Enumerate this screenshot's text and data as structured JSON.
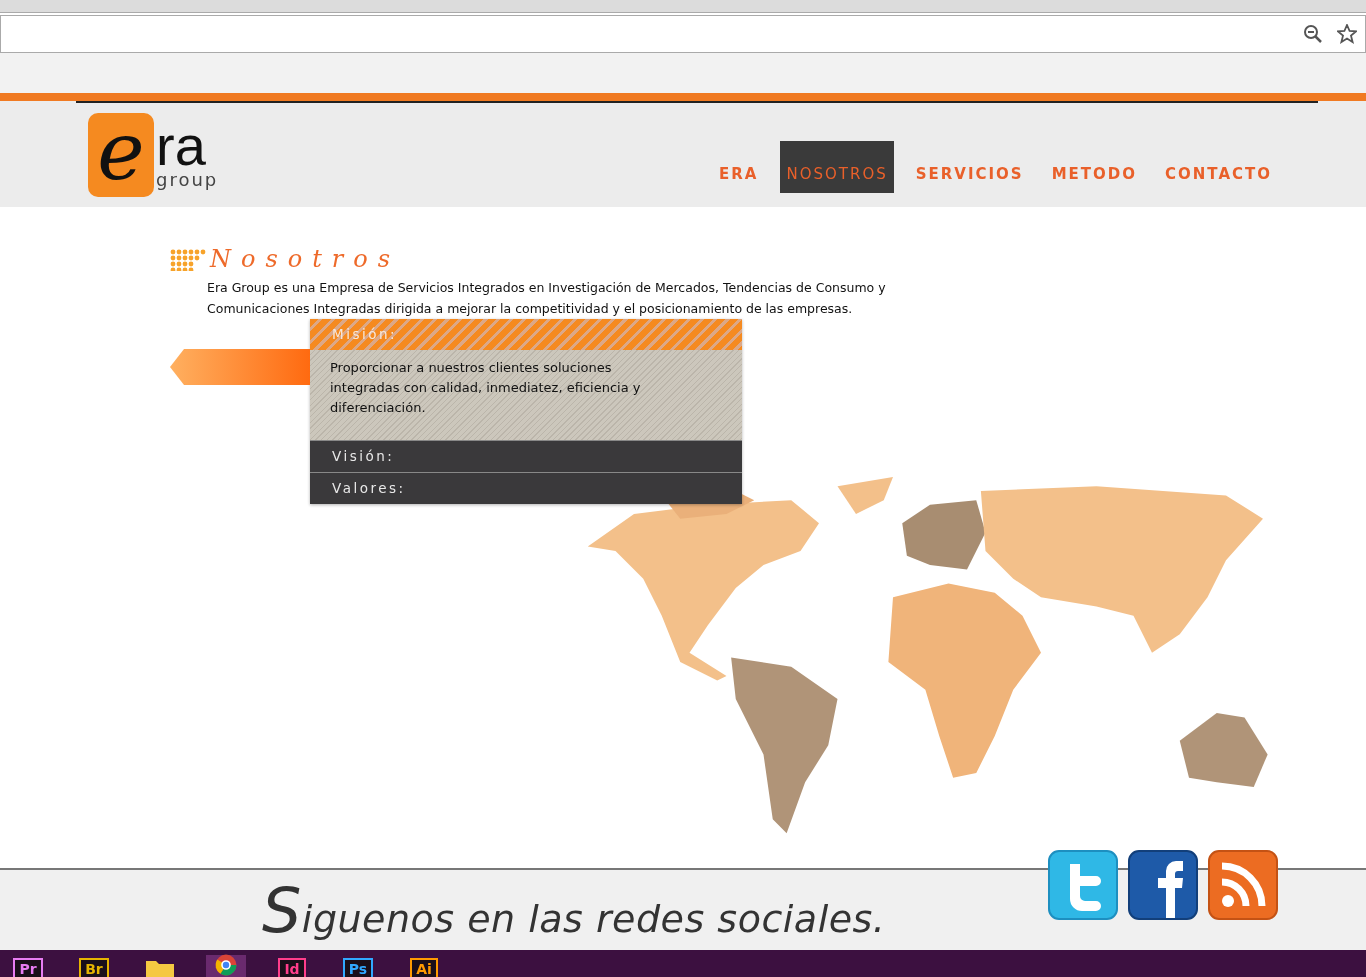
{
  "nav": [
    {
      "label": "ERA",
      "selected": false
    },
    {
      "label": "NOSOTROS",
      "selected": true
    },
    {
      "label": "SERVICIOS",
      "selected": false
    },
    {
      "label": "METODO",
      "selected": false
    },
    {
      "label": "CONTACTO",
      "selected": false
    }
  ],
  "logo": {
    "mark": "e",
    "word": "ra",
    "sub": "group"
  },
  "section": {
    "title": "Nosotros",
    "intro": "Era Group es una Empresa de Servicios Integrados en Investigación de Mercados, Tendencias de Consumo y Comunicaciones Integradas dirigida a mejorar la competitividad y el posicionamiento de las empresas."
  },
  "accordion": [
    {
      "title": "Misión:",
      "expanded": true,
      "body": "Proporcionar a nuestros clientes soluciones integradas con calidad, inmediatez, eficiencia y diferenciación."
    },
    {
      "title": "Visión:",
      "expanded": false
    },
    {
      "title": "Valores:",
      "expanded": false
    }
  ],
  "footer": {
    "initial": "S",
    "text": "iguenos en las redes sociales."
  },
  "social": [
    {
      "kind": "twitter"
    },
    {
      "kind": "facebook"
    },
    {
      "kind": "rss"
    }
  ],
  "taskbar": [
    {
      "label": "Pr",
      "color": "#e77cf2",
      "selected": false
    },
    {
      "label": "Br",
      "color": "#e6b400",
      "selected": false
    },
    {
      "kind": "folder",
      "selected": false
    },
    {
      "kind": "chrome",
      "selected": true
    },
    {
      "label": "Id",
      "color": "#ff3d8b",
      "selected": false
    },
    {
      "label": "Ps",
      "color": "#31a8ff",
      "selected": false
    },
    {
      "label": "Ai",
      "color": "#ff9a00",
      "selected": false
    }
  ]
}
